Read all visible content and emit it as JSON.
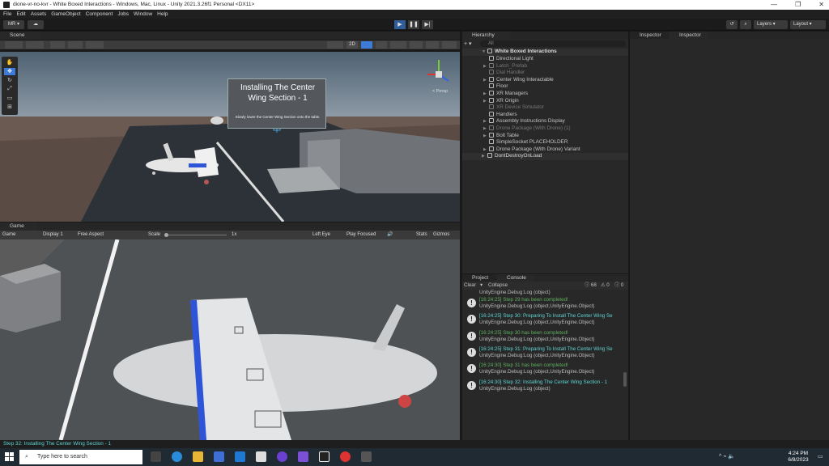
{
  "window": {
    "title": "dione-vr-no-kvr - White Boxed Interactions - Windows, Mac, Linux - Unity 2021.3.26f1 Personal <DX11>",
    "controls": [
      "—",
      "❐",
      "✕"
    ]
  },
  "menu": [
    "File",
    "Edit",
    "Assets",
    "GameObject",
    "Component",
    "Jobs",
    "Window",
    "Help"
  ],
  "toolbar": {
    "account": "MR",
    "layers": "Layers",
    "layout": "Layout"
  },
  "scene": {
    "tab": "Scene",
    "panel_title": "Installing The Center Wing Section - 1",
    "panel_body": "Slowly lower the Center Wing Section onto the table.",
    "view_label": "< Persp",
    "mode_2d": "2D"
  },
  "game": {
    "tab": "Game",
    "mode": "Game",
    "display": "Display 1",
    "aspect": "Free Aspect",
    "scale_label": "Scale",
    "scale_value": "1x",
    "eye": "Left Eye",
    "play_mode": "Play Focused",
    "stats": "Stats",
    "gizmos": "Gizmos"
  },
  "hierarchy": {
    "tab": "Hierarchy",
    "search_placeholder": "All",
    "scene_name": "White Boxed Interactions",
    "items": [
      {
        "label": "Directional Light",
        "indent": 2,
        "arrow": false,
        "dim": false
      },
      {
        "label": "Latch_Prefab",
        "indent": 2,
        "arrow": true,
        "dim": true
      },
      {
        "label": "Dial Handler",
        "indent": 2,
        "arrow": false,
        "dim": true
      },
      {
        "label": "Center Wing Interactable",
        "indent": 2,
        "arrow": true,
        "dim": false
      },
      {
        "label": "Floor",
        "indent": 2,
        "arrow": false,
        "dim": false
      },
      {
        "label": "XR Managers",
        "indent": 2,
        "arrow": true,
        "dim": false
      },
      {
        "label": "XR Origin",
        "indent": 2,
        "arrow": true,
        "dim": false
      },
      {
        "label": "XR Device Simulator",
        "indent": 2,
        "arrow": false,
        "dim": true
      },
      {
        "label": "Handlers",
        "indent": 2,
        "arrow": false,
        "dim": false
      },
      {
        "label": "Assembly Instructions Display",
        "indent": 2,
        "arrow": true,
        "dim": false
      },
      {
        "label": "Drone Package (With Drone) (1)",
        "indent": 2,
        "arrow": true,
        "dim": true
      },
      {
        "label": "Bolt Table",
        "indent": 2,
        "arrow": true,
        "dim": false
      },
      {
        "label": "SimpleSocket PLACEHOLDER",
        "indent": 2,
        "arrow": false,
        "dim": false
      },
      {
        "label": "Drone Package (With Drone) Variant",
        "indent": 2,
        "arrow": true,
        "dim": false
      }
    ],
    "dont_destroy": "DontDestroyOnLoad"
  },
  "console": {
    "tabs": [
      "Project",
      "Console"
    ],
    "clear": "Clear",
    "collapse": "Collapse",
    "count_info": "68",
    "count_warn": "0",
    "count_error": "0",
    "top_partial": "UnityEngine.Debug:Log (object)",
    "logs": [
      {
        "msg": "[16:24:25] Step 29 has been completed!",
        "color": "green",
        "trace": "UnityEngine.Debug:Log (object,UnityEngine.Object)"
      },
      {
        "msg": "[16:24:25] Step 30: Preparing To Install The Center Wing Se",
        "color": "cyan",
        "trace": "UnityEngine.Debug:Log (object,UnityEngine.Object)"
      },
      {
        "msg": "[16:24:25] Step 30 has been completed!",
        "color": "green",
        "trace": "UnityEngine.Debug:Log (object,UnityEngine.Object)"
      },
      {
        "msg": "[16:24:25] Step 31: Preparing To Install The Center Wing Se",
        "color": "cyan",
        "trace": "UnityEngine.Debug:Log (object,UnityEngine.Object)"
      },
      {
        "msg": "[16:24:30] Step 31 has been completed!",
        "color": "green",
        "trace": "UnityEngine.Debug:Log (object,UnityEngine.Object)"
      },
      {
        "msg": "[16:24:30] Step 32: Installing The Center Wing Section - 1",
        "color": "cyan",
        "trace": "UnityEngine.Debug:Log (object)"
      }
    ]
  },
  "inspector": {
    "tabs": [
      "Inspector",
      "Inspector"
    ]
  },
  "statusbar": {
    "text": "Step 32: Installing The Center Wing Section - 1"
  },
  "taskbar": {
    "search_placeholder": "Type here to search",
    "time": "4:24 PM",
    "date": "6/8/2023"
  },
  "colors": {
    "accent": "#3d7bd8",
    "success": "#5fae5f",
    "info": "#5fd3d3",
    "panel": "#282828"
  }
}
